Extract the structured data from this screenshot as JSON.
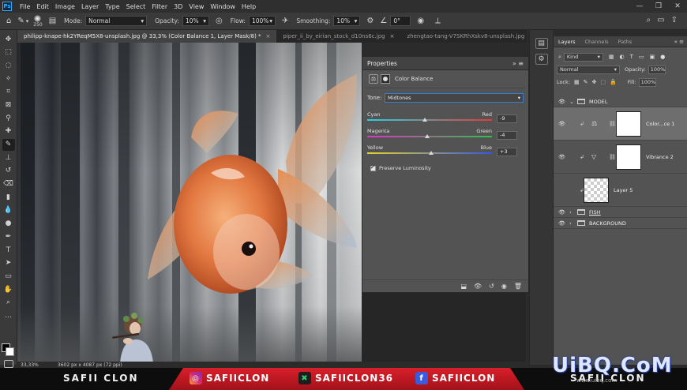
{
  "app": {
    "menu": [
      "File",
      "Edit",
      "Image",
      "Layer",
      "Type",
      "Select",
      "Filter",
      "3D",
      "View",
      "Window",
      "Help"
    ],
    "window_controls": [
      "—",
      "❐",
      "✕"
    ]
  },
  "options_bar": {
    "brush_size": "250",
    "mode_label": "Mode:",
    "mode_value": "Normal",
    "opacity_label": "Opacity:",
    "opacity_value": "10%",
    "flow_label": "Flow:",
    "flow_value": "100%",
    "smoothing_label": "Smoothing:",
    "smoothing_value": "10%",
    "angle_value": "0°"
  },
  "tabs": [
    {
      "label": "philipp-knape-hk2YReqM5X8-unsplash.jpg @ 33,3% (Color Balance 1, Layer Mask/8) *",
      "close": "×"
    },
    {
      "label": "piper_ii_by_eirian_stock_d10ns6c.jpg",
      "close": "×"
    },
    {
      "label": "zhengtao-tang-V7SKRhXskv8-unsplash.jpg",
      "close": "×"
    }
  ],
  "properties": {
    "title": "Properties",
    "controls": "» ≡",
    "adjustment_name": "Color Balance",
    "tone_label": "Tone:",
    "tone_value": "Midtones",
    "sliders": [
      {
        "left": "Cyan",
        "right": "Red",
        "value": "-9",
        "position": 0.46
      },
      {
        "left": "Magenta",
        "right": "Green",
        "value": "-4",
        "position": 0.48
      },
      {
        "left": "Yellow",
        "right": "Blue",
        "value": "+3",
        "position": 0.51
      }
    ],
    "preserve_luminosity": "Preserve Luminosity"
  },
  "layers": {
    "tabs": [
      "Layers",
      "Channels",
      "Paths"
    ],
    "panel_controls": "« ≡",
    "kind_value": "Kind",
    "blend_value": "Normal",
    "opacity_label": "Opacity:",
    "opacity_value": "100%",
    "lock_label": "Lock:",
    "fill_label": "Fill:",
    "fill_value": "100%",
    "items": [
      {
        "name": "MODEL"
      },
      {
        "name": "Color...ce 1"
      },
      {
        "name": "Vibrance 2"
      },
      {
        "name": "Layer 5"
      },
      {
        "name": "FISH"
      },
      {
        "name": "BACKGROUND"
      }
    ]
  },
  "status": {
    "zoom": "33,33%",
    "doc_size": "3602 px x 4087 px (72 ppi)"
  },
  "banner": {
    "name_left": "SAFII CLON",
    "name_right": "SAFII CLON",
    "instagram": "SAFIICLON",
    "gaming": "SAFIICLON36",
    "facebook": "SAFIICLON",
    "watermark": "UiBQ.CoM",
    "watermark_sub": "www.uibq.com"
  },
  "colors": {
    "accent": "#31a8ff",
    "banner_red": "#d81f2a",
    "panel_bg": "#535353"
  }
}
